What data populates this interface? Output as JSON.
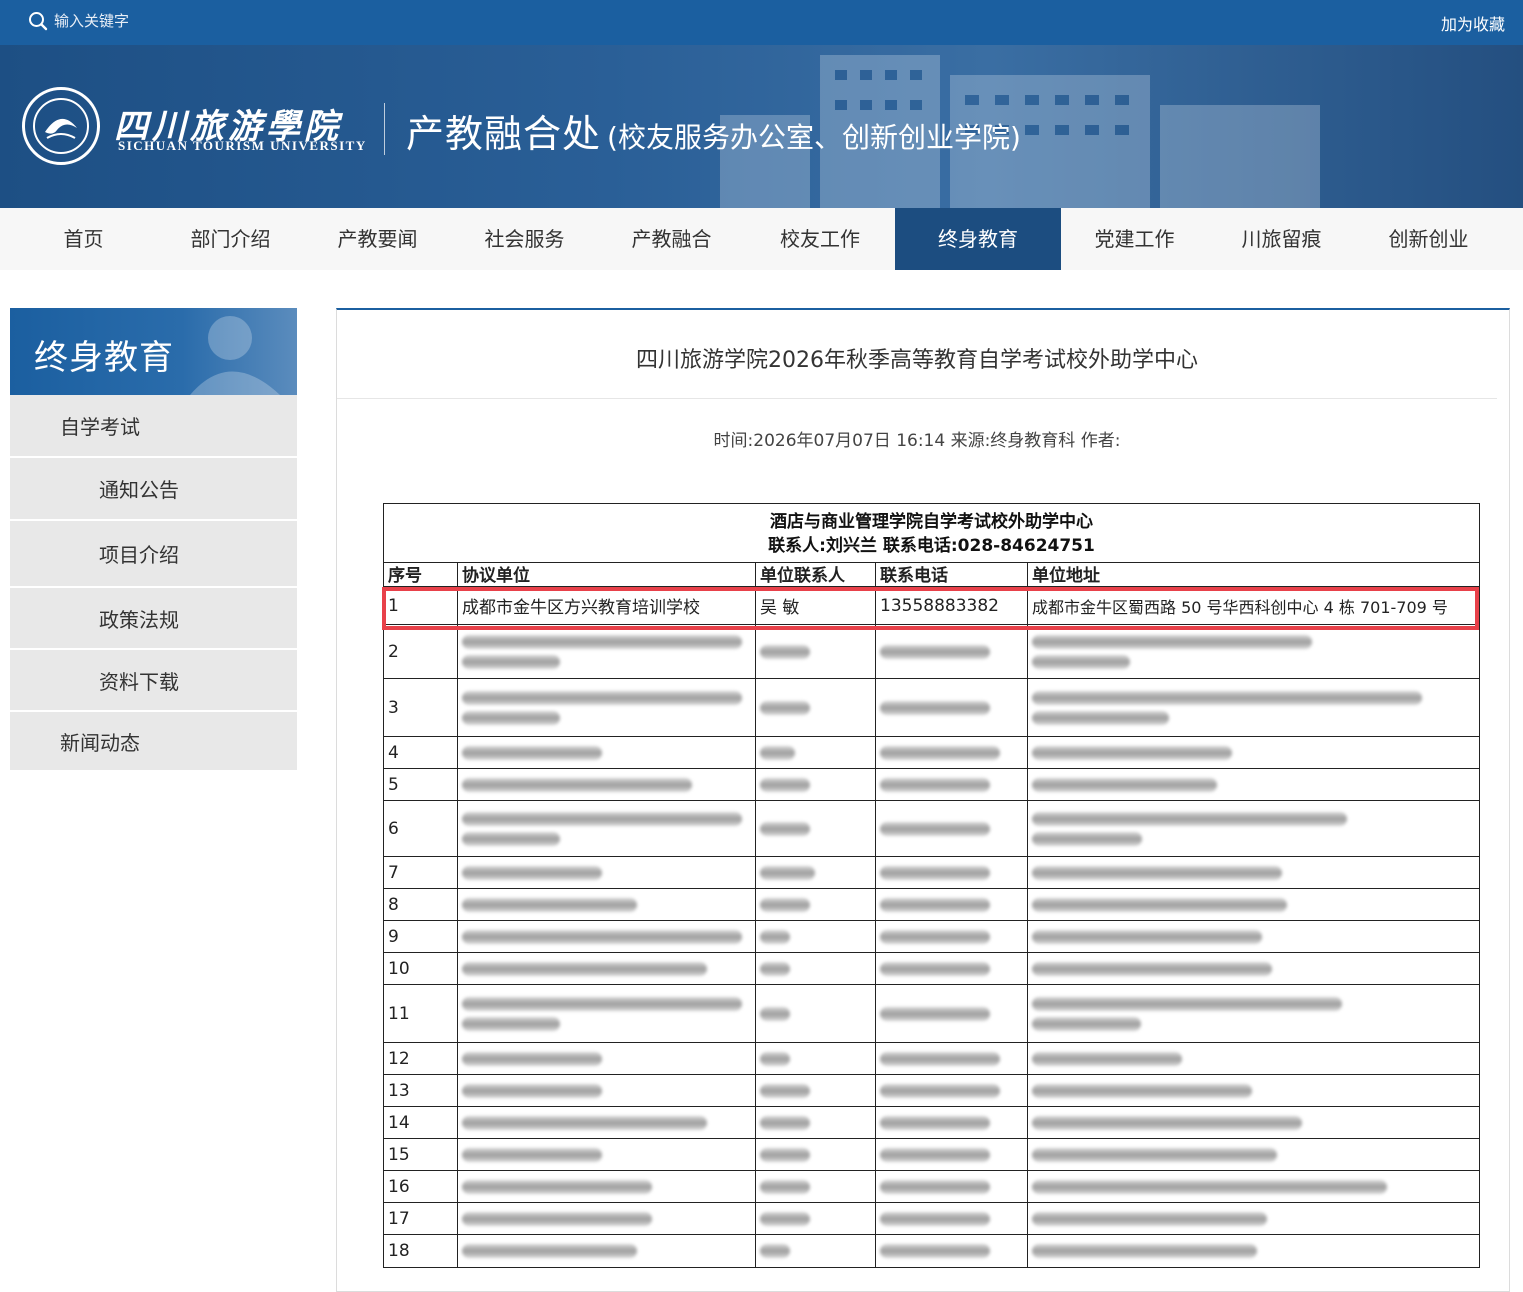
{
  "topbar": {
    "search_placeholder": "输入关键字",
    "favorite": "加为收藏"
  },
  "banner": {
    "university_cn": "四川旅游學院",
    "university_en": "SICHUAN TOURISM UNIVERSITY",
    "department": "产教融合处",
    "department_sub": "(校友服务办公室、创新创业学院)"
  },
  "nav": [
    "首页",
    "部门介绍",
    "产教要闻",
    "社会服务",
    "产教融合",
    "校友工作",
    "终身教育",
    "党建工作",
    "川旅留痕",
    "创新创业"
  ],
  "nav_active": "终身教育",
  "sidebar": {
    "title": "终身教育",
    "items": [
      "自学考试",
      "通知公告",
      "项目介绍",
      "政策法规",
      "资料下载",
      "新闻动态"
    ]
  },
  "article": {
    "title": "四川旅游学院2026年秋季高等教育自学考试校外助学中心",
    "meta": "时间:2026年07月07日 16:14 来源:终身教育科 作者:"
  },
  "table": {
    "caption": "酒店与商业管理学院自学考试校外助学中心",
    "contact": "联系人:刘兴兰   联系电话:028-84624751",
    "headers": [
      "序号",
      "协议单位",
      "单位联系人",
      "联系电话",
      "单位地址"
    ],
    "first_row": {
      "no": "1",
      "unit": "成都市金牛区方兴教育培训学校",
      "contact": "吴 敏",
      "phone": "13558883382",
      "address": "成都市金牛区蜀西路 50 号华西科创中心 4 栋 701-709 号"
    },
    "redacted_rows": [
      "2",
      "3",
      "4",
      "5",
      "6",
      "7",
      "8",
      "9",
      "10",
      "11",
      "12",
      "13",
      "14",
      "15",
      "16",
      "17",
      "18"
    ]
  },
  "colors": {
    "topbar": "#1b5fa0",
    "nav_active": "#1c4d80",
    "highlight": "#e8414a",
    "sidebar_item": "#e8e8e8"
  }
}
